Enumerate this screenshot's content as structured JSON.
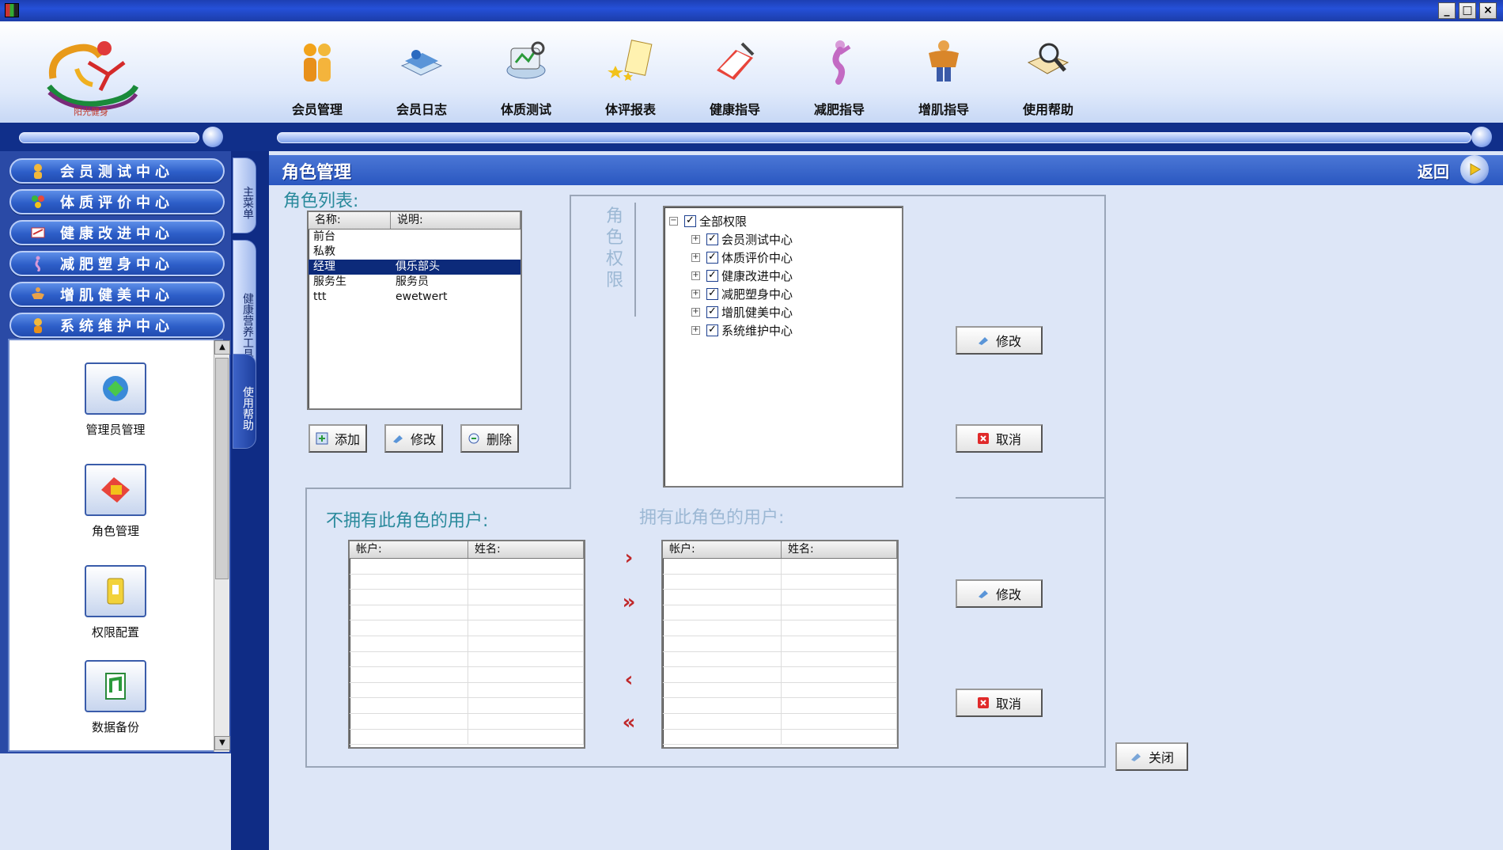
{
  "window": {
    "minimize_icon": "minimize-icon",
    "maximize_icon": "maximize-icon",
    "close_icon": "close-icon"
  },
  "logo": {
    "text": "阳光健身"
  },
  "toolbar": {
    "items": [
      {
        "label": "会员管理",
        "icon": "members-icon"
      },
      {
        "label": "会员日志",
        "icon": "member-log-icon"
      },
      {
        "label": "体质测试",
        "icon": "fitness-test-icon"
      },
      {
        "label": "体评报表",
        "icon": "report-icon"
      },
      {
        "label": "健康指导",
        "icon": "health-guide-icon"
      },
      {
        "label": "减肥指导",
        "icon": "weight-loss-icon"
      },
      {
        "label": "增肌指导",
        "icon": "muscle-gain-icon"
      },
      {
        "label": "使用帮助",
        "icon": "help-icon"
      }
    ]
  },
  "sidebar": {
    "nav": [
      {
        "label": "会员测试中心"
      },
      {
        "label": "体质评价中心"
      },
      {
        "label": "健康改进中心"
      },
      {
        "label": "减肥塑身中心"
      },
      {
        "label": "增肌健美中心"
      },
      {
        "label": "系统维护中心"
      }
    ],
    "tools": [
      {
        "label": "管理员管理",
        "icon": "admin-icon"
      },
      {
        "label": "角色管理",
        "icon": "role-icon"
      },
      {
        "label": "权限配置",
        "icon": "permission-icon"
      },
      {
        "label": "数据备份",
        "icon": "backup-icon"
      }
    ]
  },
  "vtabs": [
    {
      "label": "主菜单"
    },
    {
      "label": "健康营养工具"
    },
    {
      "label": "使用帮助"
    }
  ],
  "page": {
    "title": "角色管理",
    "back_label": "返回"
  },
  "roles": {
    "section_label": "角色列表:",
    "columns": [
      "名称:",
      "说明:"
    ],
    "rows": [
      {
        "name": "前台",
        "desc": ""
      },
      {
        "name": "私教",
        "desc": ""
      },
      {
        "name": "经理",
        "desc": "俱乐部头",
        "selected": true
      },
      {
        "name": "服务生",
        "desc": "服务员"
      },
      {
        "name": "ttt",
        "desc": "ewetwert"
      }
    ],
    "add_label": "添加",
    "edit_label": "修改",
    "delete_label": "删除"
  },
  "permissions": {
    "section_label": "角色权限",
    "root": "全部权限",
    "children": [
      "会员测试中心",
      "体质评价中心",
      "健康改进中心",
      "减肥塑身中心",
      "增肌健美中心",
      "系统维护中心"
    ],
    "edit_label": "修改",
    "cancel_label": "取消"
  },
  "users": {
    "without_label": "不拥有此角色的用户:",
    "with_label": "拥有此角色的用户:",
    "columns": [
      "帐户:",
      "姓名:"
    ],
    "move_one_right": "›",
    "move_all_right": "»",
    "move_one_left": "‹",
    "move_all_left": "«",
    "edit_label": "修改",
    "cancel_label": "取消"
  },
  "close_label": "关闭"
}
